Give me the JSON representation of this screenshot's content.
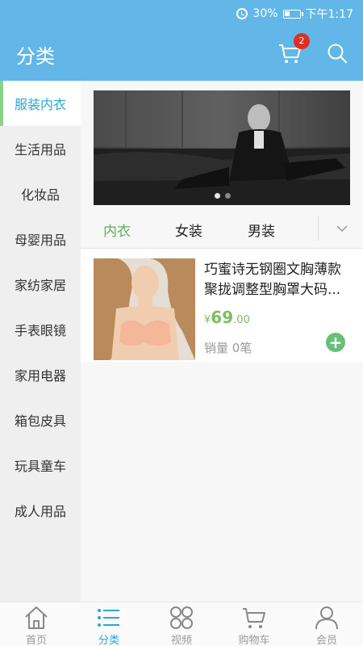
{
  "status_bar": {
    "battery": "30%",
    "time": "下午1:17",
    "battery_level": 0.3
  },
  "header": {
    "title": "分类",
    "cart_badge": "2"
  },
  "sidebar": {
    "items": [
      {
        "label": "服装内衣",
        "active": true
      },
      {
        "label": "生活用品"
      },
      {
        "label": "化妆品"
      },
      {
        "label": "母婴用品"
      },
      {
        "label": "家纺家居"
      },
      {
        "label": "手表眼镜"
      },
      {
        "label": "家用电器"
      },
      {
        "label": "箱包皮具"
      },
      {
        "label": "玩具童车"
      },
      {
        "label": "成人用品"
      }
    ]
  },
  "tabs": [
    {
      "label": "内衣",
      "active": true
    },
    {
      "label": "女装"
    },
    {
      "label": "男装"
    }
  ],
  "product": {
    "name": "巧蜜诗无钢圈文胸薄款聚拢调整型胸罩大码...",
    "price_symbol": "¥",
    "price_int": "69",
    "price_dec": ".00",
    "sales": "销量 0笔"
  },
  "bottom_nav": [
    {
      "label": "首页",
      "icon": "home-icon"
    },
    {
      "label": "分类",
      "icon": "list-icon",
      "active": true
    },
    {
      "label": "视频",
      "icon": "video-grid-icon"
    },
    {
      "label": "购物车",
      "icon": "cart-icon"
    },
    {
      "label": "会员",
      "icon": "user-icon"
    }
  ],
  "colors": {
    "primary": "#62b7e8",
    "accent_green": "#5fb05b",
    "active_blue": "#27a7d8",
    "badge_red": "#e02e24"
  }
}
